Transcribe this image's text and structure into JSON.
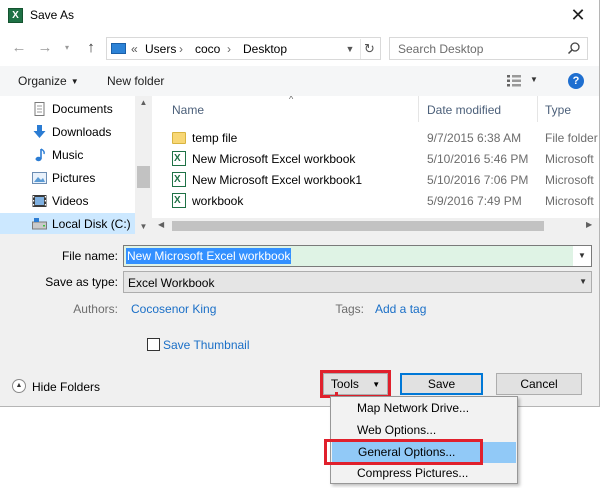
{
  "window": {
    "title": "Save As",
    "app_icon": "excel-icon",
    "close_label": "✕"
  },
  "address": {
    "prefix": "«",
    "segments": [
      "Users",
      "coco",
      "Desktop"
    ],
    "sep": "›"
  },
  "search": {
    "placeholder": "Search Desktop"
  },
  "toolbar": {
    "organize": "Organize",
    "new_folder": "New folder",
    "help": "?"
  },
  "nav": {
    "items": [
      {
        "label": "Documents",
        "icon": "documents-icon"
      },
      {
        "label": "Downloads",
        "icon": "downloads-icon"
      },
      {
        "label": "Music",
        "icon": "music-icon"
      },
      {
        "label": "Pictures",
        "icon": "pictures-icon"
      },
      {
        "label": "Videos",
        "icon": "videos-icon"
      },
      {
        "label": "Local Disk (C:)",
        "icon": "local-disk-icon",
        "selected": true
      }
    ]
  },
  "files": {
    "columns": {
      "name": "Name",
      "date": "Date modified",
      "type": "Type"
    },
    "rows": [
      {
        "name": "temp file",
        "date": "9/7/2015 6:38 AM",
        "type": "File folder",
        "icon": "folder-icon"
      },
      {
        "name": "New Microsoft Excel workbook",
        "date": "5/10/2016 5:46 PM",
        "type": "Microsoft",
        "icon": "excel-file-icon"
      },
      {
        "name": "New Microsoft Excel workbook1",
        "date": "5/10/2016 7:06 PM",
        "type": "Microsoft",
        "icon": "excel-file-icon"
      },
      {
        "name": "workbook",
        "date": "5/9/2016 7:49 PM",
        "type": "Microsoft",
        "icon": "excel-file-icon"
      }
    ]
  },
  "form": {
    "file_name_label": "File name:",
    "file_name_value": "New Microsoft Excel workbook",
    "save_as_type_label": "Save as type:",
    "save_as_type_value": "Excel Workbook",
    "authors_label": "Authors:",
    "authors_value": "Cocosenor King",
    "tags_label": "Tags:",
    "tags_value": "Add a tag",
    "save_thumbnail_label": "Save Thumbnail"
  },
  "footer": {
    "hide_folders": "Hide Folders",
    "tools": "Tools",
    "save": "Save",
    "cancel": "Cancel"
  },
  "tools_menu": {
    "items": [
      {
        "label": "Map Network Drive..."
      },
      {
        "label": "Web Options..."
      },
      {
        "label": "General Options...",
        "highlighted": true
      },
      {
        "label": "Compress Pictures..."
      }
    ]
  },
  "colors": {
    "accent": "#0078d7",
    "annotation_red": "#e0202c",
    "link": "#1a6fc7",
    "menu_highlight": "#91c9f7"
  }
}
